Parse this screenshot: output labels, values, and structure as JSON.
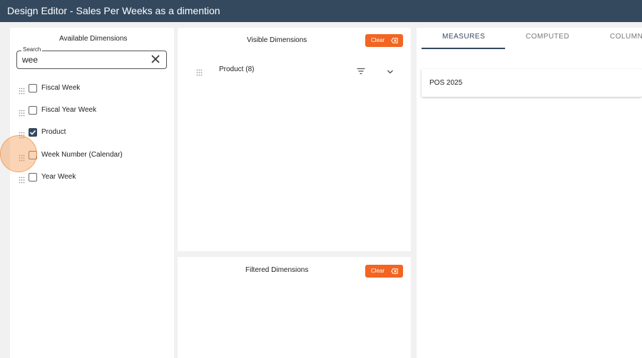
{
  "window": {
    "title": "Design Editor - Sales Per Weeks as a dimention"
  },
  "available": {
    "title": "Available Dimensions",
    "search": {
      "label": "Search",
      "value": "wee"
    },
    "items": [
      {
        "label": "Fiscal Week",
        "checked": false
      },
      {
        "label": "Fiscal Year Week",
        "checked": false
      },
      {
        "label": "Product",
        "checked": true
      },
      {
        "label": "Week Number (Calendar)",
        "checked": false
      },
      {
        "label": "Year Week",
        "checked": false
      }
    ]
  },
  "visible": {
    "title": "Visible Dimensions",
    "clear_label": "Clear",
    "items": [
      {
        "label": "Product (8)"
      }
    ]
  },
  "filtered": {
    "title": "Filtered Dimensions",
    "clear_label": "Clear"
  },
  "tabs": [
    {
      "label": "MEASURES",
      "active": true
    },
    {
      "label": "COMPUTED",
      "active": false
    },
    {
      "label": "COLUMN",
      "active": false
    }
  ],
  "measures": [
    {
      "label": "POS 2025"
    }
  ],
  "colors": {
    "header": "#34495e",
    "accent": "#f26522",
    "checkbox": "#34495e"
  },
  "icons": [
    "drag-handle-icon",
    "close-icon",
    "filter-icon",
    "chevron-down-icon",
    "backspace-icon",
    "check-icon"
  ]
}
